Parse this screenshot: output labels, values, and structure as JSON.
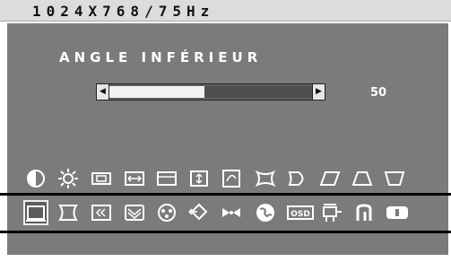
{
  "header": {
    "resolution": "1024X768/75Hz"
  },
  "osd": {
    "title": "ANGLE INFÉRIEUR",
    "slider": {
      "value": 50,
      "value_label": "50",
      "fill_fraction": 0.47
    }
  },
  "icons_top_row": [
    "contrast-icon",
    "brightness-icon",
    "horizontal-size-icon",
    "horizontal-position-icon",
    "vertical-size-icon",
    "vertical-position-icon",
    "zoom-icon",
    "pincushion-icon",
    "pin-balance-icon",
    "parallelogram-icon",
    "trapezoid-top-icon",
    "trapezoid-bottom-icon"
  ],
  "icons_bottom_row": [
    "corner-icon",
    "side-balance-icon",
    "moire-icon",
    "degauss-icon",
    "color-icon",
    "position-reset-icon",
    "convergence-icon",
    "language-icon",
    "osd-icon",
    "signal-input-icon",
    "recall-icon",
    "info-icon"
  ],
  "selected_icon": "corner-icon",
  "icon_labels": {
    "osd": "OSD"
  },
  "colors": {
    "panel": "#7b7b7b",
    "icon": "#ffffff",
    "band": "#000000"
  }
}
